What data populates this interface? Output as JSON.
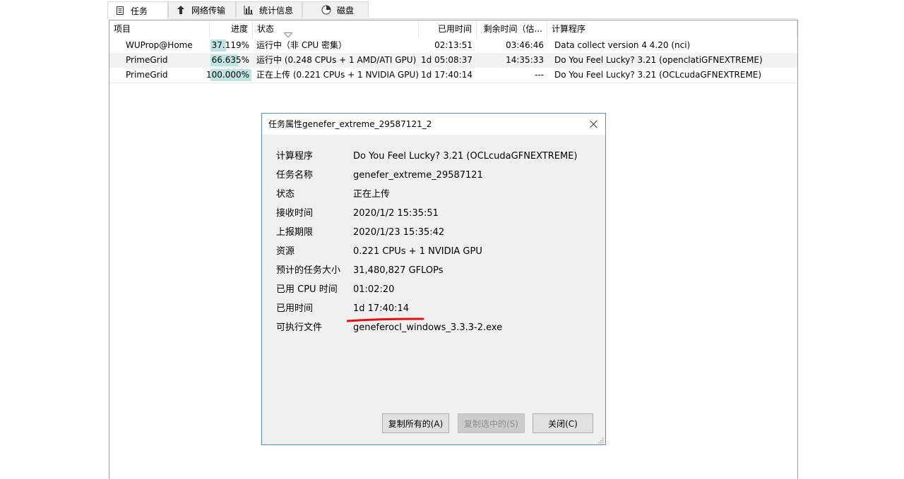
{
  "tabs": [
    {
      "label": "任务",
      "icon": "document-icon",
      "active": true
    },
    {
      "label": "网络传输",
      "icon": "transfer-icon",
      "active": false
    },
    {
      "label": "统计信息",
      "icon": "bar-chart-icon",
      "active": false
    },
    {
      "label": "磁盘",
      "icon": "disk-icon",
      "active": false
    }
  ],
  "table": {
    "headers": {
      "project": "项目",
      "progress": "进度",
      "status": "状态",
      "elapsed": "已用时间",
      "remaining": "剩余时间（估...",
      "application": "计算程序"
    },
    "rows": [
      {
        "project": "WUProp@Home",
        "progress": "37.119%",
        "progress_value": 0.37119,
        "status": "运行中（非 CPU 密集）",
        "elapsed": "02:13:51",
        "remaining": "03:46:46",
        "application": "Data collect version 4 4.20  (nci)"
      },
      {
        "project": "PrimeGrid",
        "progress": "66.635%",
        "progress_value": 0.66635,
        "status": "运行中 (0.248 CPUs + 1 AMD/ATI GPU)",
        "elapsed": "1d 05:08:37",
        "remaining": "14:35:33",
        "application": "Do You Feel Lucky? 3.21  (openclatiGFNEXTREME)"
      },
      {
        "project": "PrimeGrid",
        "progress": "100.000%",
        "progress_value": 1.0,
        "status": "正在上传 (0.221 CPUs + 1 NVIDIA GPU)",
        "elapsed": "1d 17:40:14",
        "remaining": "---",
        "application": "Do You Feel Lucky? 3.21  (OCLcudaGFNEXTREME)"
      }
    ]
  },
  "dialog": {
    "title": "任务属性genefer_extreme_29587121_2",
    "properties": [
      {
        "label": "计算程序",
        "value": "Do You Feel Lucky? 3.21 (OCLcudaGFNEXTREME)"
      },
      {
        "label": "任务名称",
        "value": "genefer_extreme_29587121"
      },
      {
        "label": "状态",
        "value": "正在上传"
      },
      {
        "label": "接收时间",
        "value": "2020/1/2 15:35:51"
      },
      {
        "label": "上报期限",
        "value": "2020/1/23 15:35:42"
      },
      {
        "label": "资源",
        "value": "0.221 CPUs + 1 NVIDIA GPU"
      },
      {
        "label": "预计的任务大小",
        "value": "31,480,827 GFLOPs"
      },
      {
        "label": "已用 CPU 时间",
        "value": "01:02:20"
      },
      {
        "label": "已用时间",
        "value": "1d 17:40:14"
      },
      {
        "label": "可执行文件",
        "value": "geneferocl_windows_3.3.3-2.exe"
      }
    ],
    "buttons": {
      "copy_all": "复制所有的(A)",
      "copy_selected": "复制选中的(S)",
      "close": "关闭(C)"
    },
    "highlight_color": "#e01010"
  }
}
